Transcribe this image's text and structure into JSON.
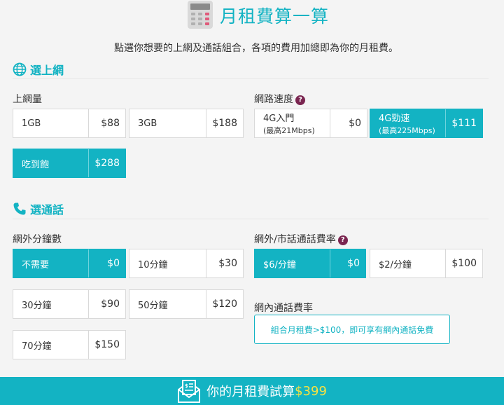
{
  "header": {
    "title": "月租費算一算",
    "subtitle": "點選你想要的上網及通話組合，各項的費用加總即為你的月租費。"
  },
  "internet": {
    "section_label": "選上網",
    "data_label": "上網量",
    "data_options": [
      {
        "name": "1GB",
        "price": "$88",
        "selected": false
      },
      {
        "name": "3GB",
        "price": "$188",
        "selected": false
      },
      {
        "name": "吃到飽",
        "price": "$288",
        "selected": true
      }
    ],
    "speed_label": "網路速度",
    "speed_options": [
      {
        "name": "4G入門",
        "sub": "(最高21Mbps)",
        "price": "$0",
        "selected": false
      },
      {
        "name": "4G勁速",
        "sub": "(最高225Mbps)",
        "price": "$111",
        "selected": true
      }
    ]
  },
  "call": {
    "section_label": "選通話",
    "minutes_label": "網外分鐘數",
    "minutes_options": [
      {
        "name": "不需要",
        "price": "$0",
        "selected": true
      },
      {
        "name": "10分鐘",
        "price": "$30",
        "selected": false
      },
      {
        "name": "30分鐘",
        "price": "$90",
        "selected": false
      },
      {
        "name": "50分鐘",
        "price": "$120",
        "selected": false
      },
      {
        "name": "70分鐘",
        "price": "$150",
        "selected": false
      }
    ],
    "rate_label": "網外/市話通話費率",
    "rate_options": [
      {
        "name": "$6/分鐘",
        "price": "$0",
        "selected": true
      },
      {
        "name": "$2/分鐘",
        "price": "$100",
        "selected": false
      }
    ],
    "onnet_label": "網內通話費率",
    "onnet_note": "組合月租費>$100，即可享有網內通話免費"
  },
  "summary": {
    "label": "你的月租費試算",
    "total": "$399"
  },
  "colors": {
    "accent": "#13b3c3",
    "total_highlight": "#f7e241",
    "help_badge": "#7a2550"
  },
  "icons": {
    "help": "?"
  }
}
